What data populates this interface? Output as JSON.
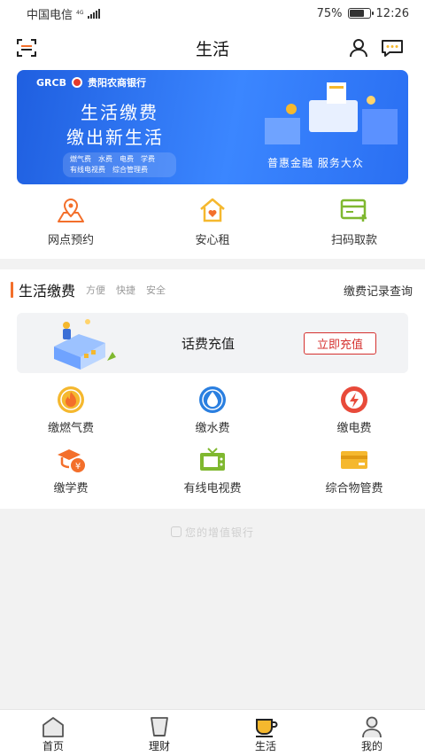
{
  "status_bar": {
    "carrier": "中国电信",
    "network_tag": "4G",
    "battery": "75%",
    "battery_level": 0.75,
    "time": "12:26"
  },
  "header": {
    "title": "生活",
    "icons": {
      "left": "scan-icon",
      "profile": "user-icon",
      "message": "message-icon"
    }
  },
  "banner": {
    "brand_abbr": "GRCB",
    "brand_name": "贵阳农商银行",
    "headline_1": "生活缴费",
    "headline_2": "缴出新生活",
    "tags_line_1": [
      "燃气费",
      "水费",
      "电费",
      "学费"
    ],
    "tags_line_2": [
      "有线电视费",
      "综合管理费"
    ],
    "slogan": "普惠金融  服务大众"
  },
  "quick_actions": [
    {
      "label": "网点预约",
      "icon": "map-pin-icon"
    },
    {
      "label": "安心租",
      "icon": "house-heart-icon"
    },
    {
      "label": "扫码取款",
      "icon": "card-plus-icon"
    }
  ],
  "section": {
    "title": "生活缴费",
    "subtitles": [
      "方便",
      "快捷",
      "安全"
    ],
    "link": "缴费记录查询",
    "recharge": {
      "label": "话费充值",
      "button": "立即充值"
    },
    "items": [
      {
        "label": "缴燃气费",
        "icon": "flame-icon"
      },
      {
        "label": "缴水费",
        "icon": "water-drop-icon"
      },
      {
        "label": "缴电费",
        "icon": "lightning-icon"
      },
      {
        "label": "缴学费",
        "icon": "graduation-cap-icon"
      },
      {
        "label": "有线电视费",
        "icon": "tv-icon"
      },
      {
        "label": "综合物管费",
        "icon": "card-icon"
      }
    ]
  },
  "footer_mark": "您的增值银行",
  "tabbar": [
    {
      "label": "首页",
      "icon": "home-icon",
      "active": false
    },
    {
      "label": "理财",
      "icon": "wealth-icon",
      "active": false
    },
    {
      "label": "生活",
      "icon": "life-cup-icon",
      "active": true
    },
    {
      "label": "我的",
      "icon": "profile-icon",
      "active": false
    }
  ],
  "colors": {
    "accent_orange": "#f36f2b",
    "accent_red": "#d5312f",
    "banner_blue": "#2a6ff2",
    "icon_yellow": "#f5b82e"
  }
}
